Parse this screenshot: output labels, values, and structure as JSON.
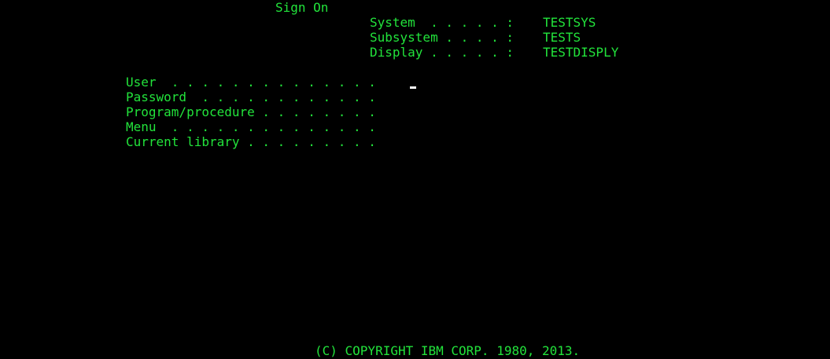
{
  "screen": {
    "title": "Sign On",
    "colors": {
      "background": "#000000",
      "text": "#22e33b",
      "cursor": "#ffffff"
    }
  },
  "system_info": {
    "system": {
      "label": "System  . . . . . :",
      "value": "TESTSYS"
    },
    "subsystem": {
      "label": "Subsystem . . . . :",
      "value": "TESTS"
    },
    "display": {
      "label": "Display . . . . . :",
      "value": "TESTDISPLY"
    }
  },
  "fields": {
    "user": {
      "label": "User  . . . . . . . . . . . . . .",
      "value": ""
    },
    "password": {
      "label": "Password  . . . . . . . . . . . .",
      "value": ""
    },
    "program": {
      "label": "Program/procedure . . . . . . . .",
      "value": ""
    },
    "menu": {
      "label": "Menu  . . . . . . . . . . . . . .",
      "value": ""
    },
    "library": {
      "label": "Current library . . . . . . . . .",
      "value": ""
    }
  },
  "footer": {
    "copyright": "(C) COPYRIGHT IBM CORP. 1980, 2013."
  }
}
